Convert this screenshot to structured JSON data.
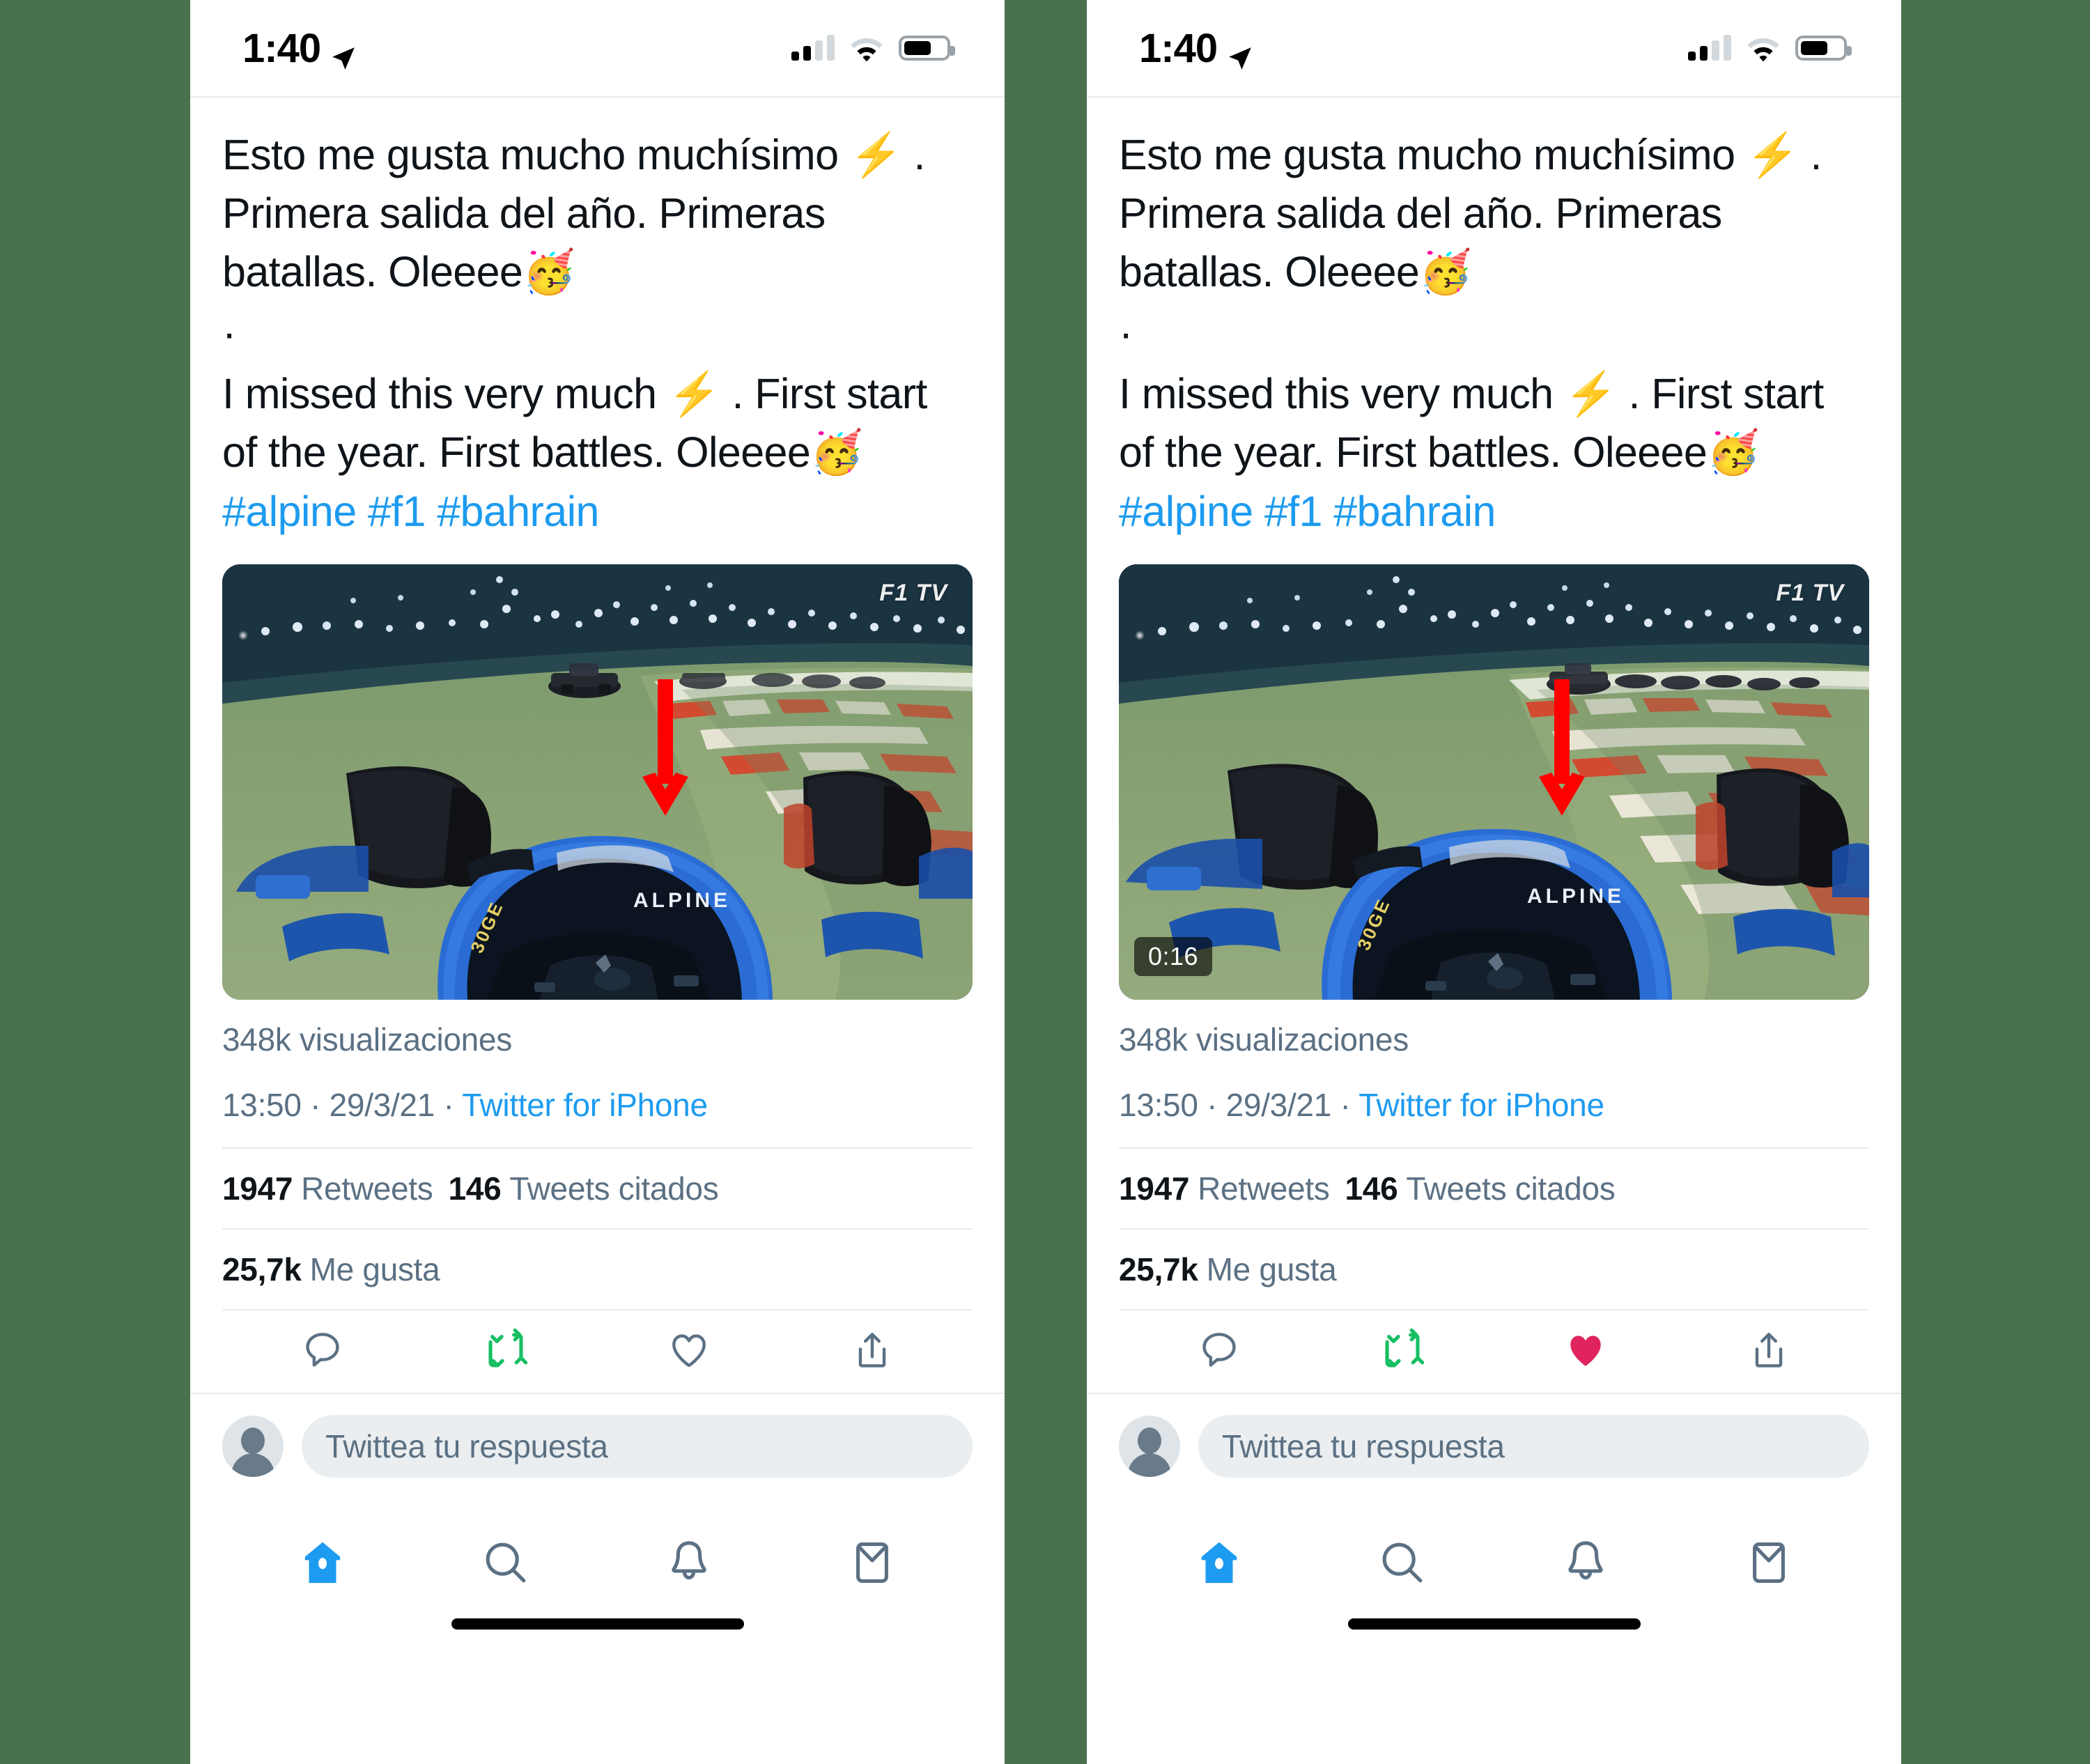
{
  "background_color": "#49714d",
  "accent_color": "#1d9bf0",
  "like_active_color": "#e0245e",
  "retweet_color": "#17bf63",
  "annotation_color": "#ff0000",
  "status_bar": {
    "time": "1:40",
    "location_icon": "location-arrow-icon",
    "signal_icon": "cellular-signal-icon",
    "wifi_icon": "wifi-icon",
    "battery_icon": "battery-icon",
    "battery_level_percent": 58,
    "signal_bars_filled": 2,
    "signal_bars_total": 4
  },
  "tweet": {
    "line1": "Esto me gusta mucho muchísimo ⚡ .",
    "line2": "Primera salida del año. Primeras",
    "line3_prefix": "batallas. Oleeee",
    "line3_emoji": "🥳",
    "separator_dot": "·",
    "line4": "I missed this very much ⚡ .  First start",
    "line5_prefix": "of the year.  First battles.  Oleeee",
    "line5_emoji": "🥳",
    "hashtags": "#alpine #f1 #bahrain",
    "media": {
      "watermark": "F1 TV",
      "car_livery_text": "ALPINE",
      "duration_left": "",
      "duration_right": "0:16",
      "alt": "F1 onboard camera view of an Alpine car at the Bahrain night Grand Prix"
    },
    "views": "348k visualizaciones",
    "time_posted": "13:50",
    "date_posted": "29/3/21",
    "source": "Twitter for iPhone",
    "dot": "·",
    "retweets_count": "1947",
    "retweets_label": "Retweets",
    "quotes_count": "146",
    "quotes_label": "Tweets citados",
    "likes_count": "25,7k",
    "likes_label": "Me gusta"
  },
  "actions": {
    "reply": "reply-icon",
    "retweet": "retweet-icon",
    "like": "like-heart-icon",
    "share": "share-icon"
  },
  "reply_bar": {
    "avatar": "default-avatar",
    "placeholder": "Twittea tu respuesta"
  },
  "tab_bar": {
    "home": "home-icon",
    "search": "search-icon",
    "notifications": "bell-icon",
    "messages": "envelope-icon",
    "active_tab": "home"
  },
  "panels": [
    {
      "id": "before",
      "like_state": "unliked",
      "video_duration_visible": false,
      "annotation": "red-arrow-pointing-to-like-button"
    },
    {
      "id": "after",
      "like_state": "liked",
      "video_duration_visible": true,
      "annotation": "red-arrow-pointing-to-like-button"
    }
  ]
}
